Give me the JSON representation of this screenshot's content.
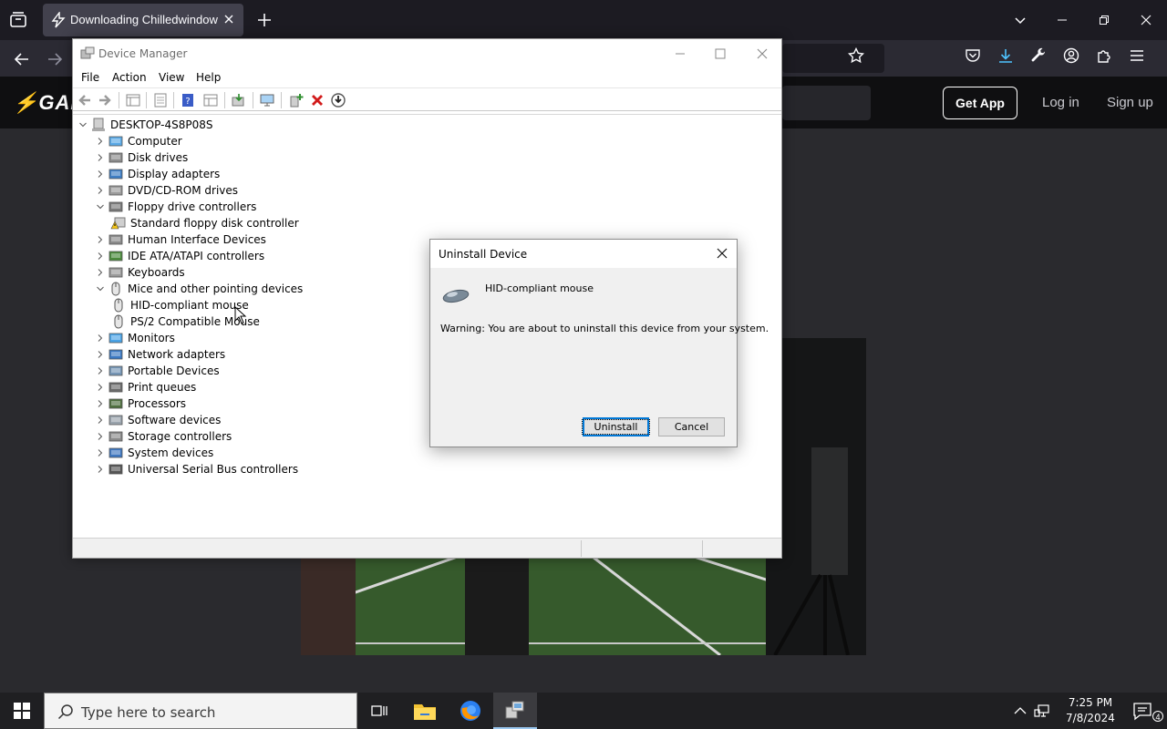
{
  "browser": {
    "tab_title": "Downloading Chilledwindows.exe",
    "colors": {
      "chrome_dark": "#1c1b22",
      "tab_active": "#42414d",
      "toolbar": "#2b2a33"
    }
  },
  "site": {
    "logo_text": "GAM",
    "get_app_label": "Get App",
    "login_label": "Log in",
    "signup_label": "Sign up"
  },
  "device_manager": {
    "title": "Device Manager",
    "menu": [
      "File",
      "Action",
      "View",
      "Help"
    ],
    "root": "DESKTOP-4S8P08S",
    "tree": [
      {
        "label": "Computer",
        "state": "collapsed",
        "icon": "computer-icon"
      },
      {
        "label": "Disk drives",
        "state": "collapsed",
        "icon": "disk-drive-icon"
      },
      {
        "label": "Display adapters",
        "state": "collapsed",
        "icon": "display-adapter-icon"
      },
      {
        "label": "DVD/CD-ROM drives",
        "state": "collapsed",
        "icon": "dvd-drive-icon"
      },
      {
        "label": "Floppy drive controllers",
        "state": "expanded",
        "icon": "floppy-controller-icon"
      },
      {
        "label": "Standard floppy disk controller",
        "state": "child",
        "icon": "warning-device-icon"
      },
      {
        "label": "Human Interface Devices",
        "state": "collapsed",
        "icon": "hid-icon"
      },
      {
        "label": "IDE ATA/ATAPI controllers",
        "state": "collapsed",
        "icon": "ide-controller-icon"
      },
      {
        "label": "Keyboards",
        "state": "collapsed",
        "icon": "keyboard-icon"
      },
      {
        "label": "Mice and other pointing devices",
        "state": "expanded",
        "icon": "mouse-icon"
      },
      {
        "label": "HID-compliant mouse",
        "state": "child",
        "icon": "mouse-icon"
      },
      {
        "label": "PS/2 Compatible Mouse",
        "state": "child",
        "icon": "mouse-icon"
      },
      {
        "label": "Monitors",
        "state": "collapsed",
        "icon": "monitor-icon"
      },
      {
        "label": "Network adapters",
        "state": "collapsed",
        "icon": "network-adapter-icon"
      },
      {
        "label": "Portable Devices",
        "state": "collapsed",
        "icon": "portable-device-icon"
      },
      {
        "label": "Print queues",
        "state": "collapsed",
        "icon": "printer-icon"
      },
      {
        "label": "Processors",
        "state": "collapsed",
        "icon": "processor-icon"
      },
      {
        "label": "Software devices",
        "state": "collapsed",
        "icon": "software-device-icon"
      },
      {
        "label": "Storage controllers",
        "state": "collapsed",
        "icon": "storage-controller-icon"
      },
      {
        "label": "System devices",
        "state": "collapsed",
        "icon": "system-device-icon"
      },
      {
        "label": "Universal Serial Bus controllers",
        "state": "collapsed",
        "icon": "usb-icon"
      }
    ]
  },
  "dialog": {
    "title": "Uninstall Device",
    "device_name": "HID-compliant mouse",
    "warning": "Warning: You are about to uninstall this device from your system.",
    "uninstall_label": "Uninstall",
    "cancel_label": "Cancel"
  },
  "taskbar": {
    "search_placeholder": "Type here to search",
    "time": "7:25 PM",
    "date": "7/8/2024",
    "notification_count": "4"
  }
}
